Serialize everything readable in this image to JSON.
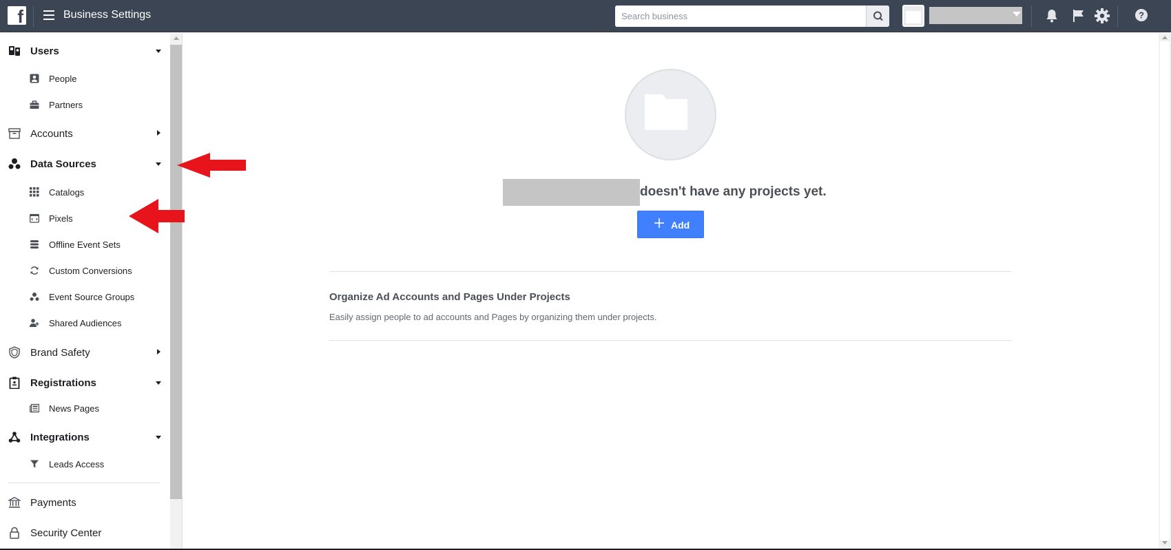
{
  "topbar": {
    "logo": "f",
    "title": "Business Settings",
    "search_placeholder": "Search business"
  },
  "sidebar": {
    "sections": [
      {
        "label": "Users",
        "state": "expanded",
        "icon": "users-icon"
      },
      {
        "label": "Accounts",
        "state": "collapsed",
        "icon": "accounts-icon"
      },
      {
        "label": "Data Sources",
        "state": "expanded",
        "icon": "data-sources-icon"
      },
      {
        "label": "Brand Safety",
        "state": "collapsed",
        "icon": "shield-icon"
      },
      {
        "label": "Registrations",
        "state": "expanded",
        "icon": "clipboard-icon"
      },
      {
        "label": "Integrations",
        "state": "expanded",
        "icon": "integrations-icon"
      },
      {
        "label": "Payments",
        "state": "none",
        "icon": "bank-icon"
      },
      {
        "label": "Security Center",
        "state": "none",
        "icon": "lock-icon"
      }
    ],
    "items": [
      {
        "label": "People",
        "icon": "person-icon"
      },
      {
        "label": "Partners",
        "icon": "briefcase-icon"
      },
      {
        "label": "Catalogs",
        "icon": "grid-icon"
      },
      {
        "label": "Pixels",
        "icon": "pixel-icon"
      },
      {
        "label": "Offline Event Sets",
        "icon": "stack-icon"
      },
      {
        "label": "Custom Conversions",
        "icon": "refresh-icon"
      },
      {
        "label": "Event Source Groups",
        "icon": "event-group-icon"
      },
      {
        "label": "Shared Audiences",
        "icon": "audience-icon"
      },
      {
        "label": "News Pages",
        "icon": "newspaper-icon"
      },
      {
        "label": "Leads Access",
        "icon": "filter-icon"
      }
    ]
  },
  "main": {
    "empty_message": "doesn't have any projects yet.",
    "add_label": "Add",
    "info_title": "Organize Ad Accounts and Pages Under Projects",
    "info_subtitle": "Easily assign people to ad accounts and Pages by organizing them under projects."
  },
  "colors": {
    "topbar": "#3b4554",
    "primary_button": "#4080ff",
    "annotation_arrow": "#e8141c"
  }
}
